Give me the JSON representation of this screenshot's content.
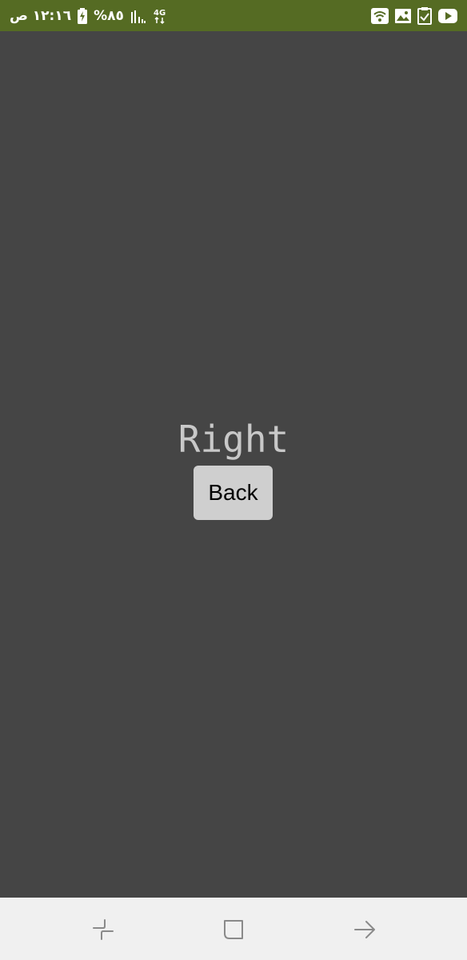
{
  "status_bar": {
    "time": "١٢:١٦ ص",
    "battery_percent": "%٨٥",
    "network_type": "4G",
    "icons": [
      "charging-battery-icon",
      "signal-icon",
      "network-4g-icon",
      "wifi-icon",
      "image-icon",
      "task-icon",
      "youtube-icon"
    ],
    "background_color": "#556b23"
  },
  "main": {
    "title": "Right",
    "back_button_label": "Back",
    "background_color": "#454545"
  },
  "nav_bar": {
    "buttons": [
      "recent-apps-icon",
      "home-icon",
      "back-arrow-icon"
    ],
    "background_color": "#f0f0f0"
  }
}
